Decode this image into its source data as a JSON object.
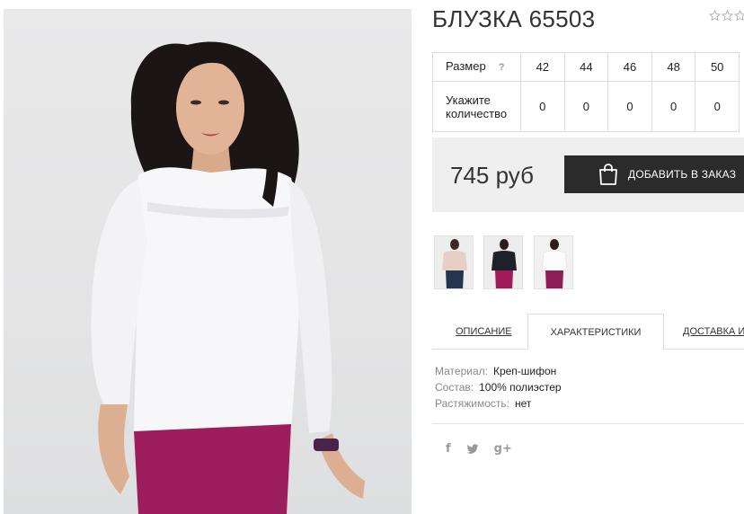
{
  "product": {
    "title": "БЛУЗКА 65503",
    "rating_stars": 3,
    "rating_value": 0
  },
  "size_table": {
    "size_label": "Размер",
    "help_mark": "?",
    "sizes": [
      "42",
      "44",
      "46",
      "48",
      "50"
    ],
    "qty_label_line1": "Укажите",
    "qty_label_line2": "количество",
    "quantities": [
      "0",
      "0",
      "0",
      "0",
      "0"
    ]
  },
  "buy": {
    "price": "745 руб",
    "add_button_label": "ДОБАВИТЬ В ЗАКАЗ",
    "button_icon": "shopping-bag-icon"
  },
  "thumbnails": [
    {
      "name": "thumb-blush-blouse",
      "top": "#e8cfc6",
      "bottom": "#26354f"
    },
    {
      "name": "thumb-black-blouse",
      "top": "#1f2128",
      "bottom": "#a11a5a"
    },
    {
      "name": "thumb-white-blouse",
      "top": "#f6f6f6",
      "bottom": "#8c1d56"
    }
  ],
  "tabs": {
    "description": "ОПИСАНИЕ",
    "characteristics": "ХАРАКТЕРИСТИКИ",
    "delivery": "ДОСТАВКА И"
  },
  "specs": [
    {
      "key": "Материал:",
      "value": "Креп-шифон"
    },
    {
      "key": "Состав:",
      "value": "100% полиэстер"
    },
    {
      "key": "Растяжимость:",
      "value": "нет"
    }
  ],
  "share": {
    "facebook": "f",
    "twitter_icon": "twitter-icon",
    "googleplus": "g+"
  },
  "colors": {
    "accent_dark": "#2b2b2b",
    "buy_panel": "#efefef",
    "border": "#dcdcdc"
  }
}
